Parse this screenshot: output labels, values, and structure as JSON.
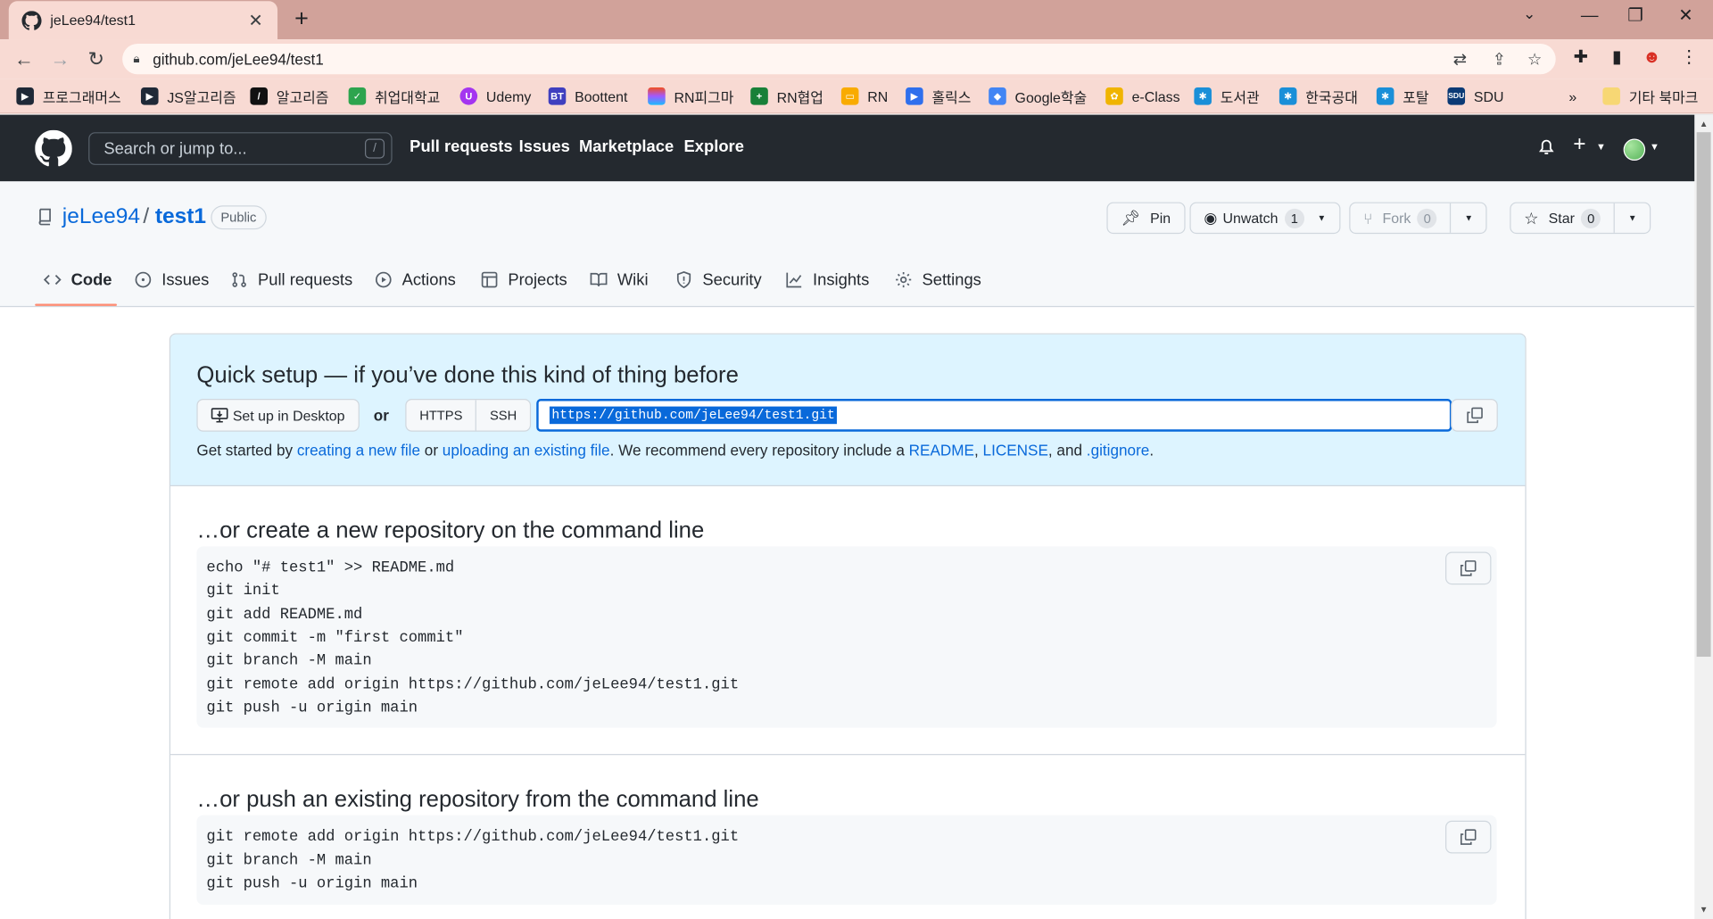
{
  "browser": {
    "tab_title": "jeLee94/test1",
    "url": "github.com/jeLee94/test1",
    "bookmarks": [
      "프로그래머스",
      "JS알고리즘",
      "알고리즘",
      "취업대학교",
      "Udemy",
      "Boottent",
      "RN피그마",
      "RN협업",
      "RN",
      "홀릭스",
      "Google학술",
      "e-Class",
      "도서관",
      "한국공대",
      "포탈",
      "SDU"
    ],
    "bookmarks_more": "»",
    "other_bookmarks": "기타 북마크"
  },
  "github": {
    "search_placeholder": "Search or jump to...",
    "search_shortcut": "/",
    "nav": [
      "Pull requests",
      "Issues",
      "Marketplace",
      "Explore"
    ]
  },
  "repo": {
    "owner": "jeLee94",
    "separator": "/",
    "name": "test1",
    "visibility": "Public",
    "pin_label": "Pin",
    "unwatch_label": "Unwatch",
    "watch_count": "1",
    "fork_label": "Fork",
    "fork_count": "0",
    "star_label": "Star",
    "star_count": "0",
    "tabs": [
      "Code",
      "Issues",
      "Pull requests",
      "Actions",
      "Projects",
      "Wiki",
      "Security",
      "Insights",
      "Settings"
    ],
    "active_tab": "Code"
  },
  "quick_setup": {
    "title": "Quick setup — if you’ve done this kind of thing before",
    "desktop_button": "Set up in Desktop",
    "or": "or",
    "protocols": [
      "HTTPS",
      "SSH"
    ],
    "clone_url": "https://github.com/jeLee94/test1.git",
    "help": {
      "p1": "Get started by ",
      "link1": "creating a new file",
      "p2": " or ",
      "link2": "uploading an existing file",
      "p3": ". We recommend every repository include a ",
      "link3": "README",
      "p4": ", ",
      "link4": "LICENSE",
      "p5": ", and ",
      "link5": ".gitignore",
      "p6": "."
    }
  },
  "new_repo": {
    "title": "…or create a new repository on the command line",
    "lines": [
      "echo \"# test1\" >> README.md",
      "git init",
      "git add README.md",
      "git commit -m \"first commit\"",
      "git branch -M main",
      "git remote add origin https://github.com/jeLee94/test1.git",
      "git push -u origin main"
    ]
  },
  "push_repo": {
    "title": "…or push an existing repository from the command line",
    "lines": [
      "git remote add origin https://github.com/jeLee94/test1.git",
      "git branch -M main",
      "git push -u origin main"
    ]
  },
  "colors": {
    "header_bg": "#24292f",
    "link": "#0969da",
    "quick_setup_bg": "#ddf4ff",
    "active_tab_underline": "#fd8c73",
    "chrome_tabbar": "#d1a29a",
    "chrome_toolbar": "#f8dad3"
  }
}
